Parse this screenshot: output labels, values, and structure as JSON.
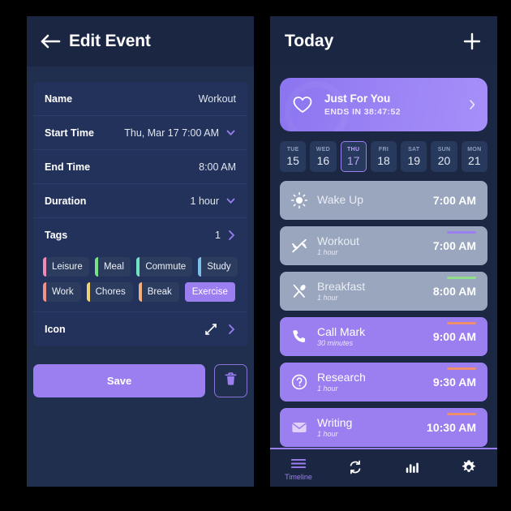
{
  "theme": {
    "accent": "#9b7ff0",
    "panel_bg": "#212f4f",
    "header_bg": "#1b2742",
    "card_bg": "#23325a",
    "past_event_bg": "#9aa6bd"
  },
  "edit_panel": {
    "back_icon": "arrow-left-icon",
    "title": "Edit Event",
    "rows": [
      {
        "label": "Name",
        "value": "Workout",
        "control": "none"
      },
      {
        "label": "Start Time",
        "value": "Thu, Mar 17 7:00 AM",
        "control": "chevron-down"
      },
      {
        "label": "End Time",
        "value": "8:00 AM",
        "control": "none"
      },
      {
        "label": "Duration",
        "value": "1 hour",
        "control": "chevron-down"
      }
    ],
    "tags_row": {
      "label": "Tags",
      "count": "1",
      "control": "chevron-right"
    },
    "tags": [
      {
        "label": "Leisure",
        "color": "#f08ab6",
        "selected": false
      },
      {
        "label": "Meal",
        "color": "#79e08a",
        "selected": false
      },
      {
        "label": "Commute",
        "color": "#6fe3c0",
        "selected": false
      },
      {
        "label": "Study",
        "color": "#7cc0ea",
        "selected": false
      },
      {
        "label": "Work",
        "color": "#f0918c",
        "selected": false
      },
      {
        "label": "Chores",
        "color": "#efd179",
        "selected": false
      },
      {
        "label": "Break",
        "color": "#efb082",
        "selected": false
      },
      {
        "label": "Exercise",
        "color": "#9b7ff0",
        "selected": true
      }
    ],
    "icon_row": {
      "label": "Icon",
      "icon": "expand-diagonal-icon",
      "control": "chevron-right"
    },
    "save_label": "Save",
    "delete_icon": "trash-icon"
  },
  "today_panel": {
    "title": "Today",
    "add_icon": "plus-icon",
    "promo": {
      "icon": "heart-icon",
      "title": "Just For You",
      "subtitle": "ENDS IN  38:47:52",
      "chevron": "chevron-right-icon"
    },
    "dates": [
      {
        "dow": "TUE",
        "day": "15",
        "selected": false
      },
      {
        "dow": "WED",
        "day": "16",
        "selected": false
      },
      {
        "dow": "THU",
        "day": "17",
        "selected": true
      },
      {
        "dow": "FRI",
        "day": "18",
        "selected": false
      },
      {
        "dow": "SAT",
        "day": "19",
        "selected": false
      },
      {
        "dow": "SUN",
        "day": "20",
        "selected": false
      },
      {
        "dow": "MON",
        "day": "21",
        "selected": false
      }
    ],
    "events": [
      {
        "title": "Wake Up",
        "duration": "",
        "time": "7:00 AM",
        "state": "past",
        "icon": "sun-icon",
        "accent": ""
      },
      {
        "title": "Workout",
        "duration": "1 hour",
        "time": "7:00 AM",
        "state": "past",
        "icon": "dumbbell-icon",
        "accent": "#9b7ff0"
      },
      {
        "title": "Breakfast",
        "duration": "1 hour",
        "time": "8:00 AM",
        "state": "past",
        "icon": "cutlery-icon",
        "accent": "#8fdf8a"
      },
      {
        "title": "Call Mark",
        "duration": "30 minutes",
        "time": "9:00 AM",
        "state": "upcoming",
        "icon": "phone-icon",
        "accent": "#f08f6e"
      },
      {
        "title": "Research",
        "duration": "1 hour",
        "time": "9:30 AM",
        "state": "upcoming",
        "icon": "question-icon",
        "accent": "#f08f6e"
      },
      {
        "title": "Writing",
        "duration": "1 hour",
        "time": "10:30 AM",
        "state": "upcoming",
        "icon": "envelope-icon",
        "accent": "#f08f6e"
      }
    ],
    "nav": [
      {
        "label": "Timeline",
        "icon": "menu-lines-icon",
        "active": true
      },
      {
        "label": "",
        "icon": "sync-icon",
        "active": false
      },
      {
        "label": "",
        "icon": "bar-chart-icon",
        "active": false
      },
      {
        "label": "",
        "icon": "gear-icon",
        "active": false
      }
    ]
  }
}
